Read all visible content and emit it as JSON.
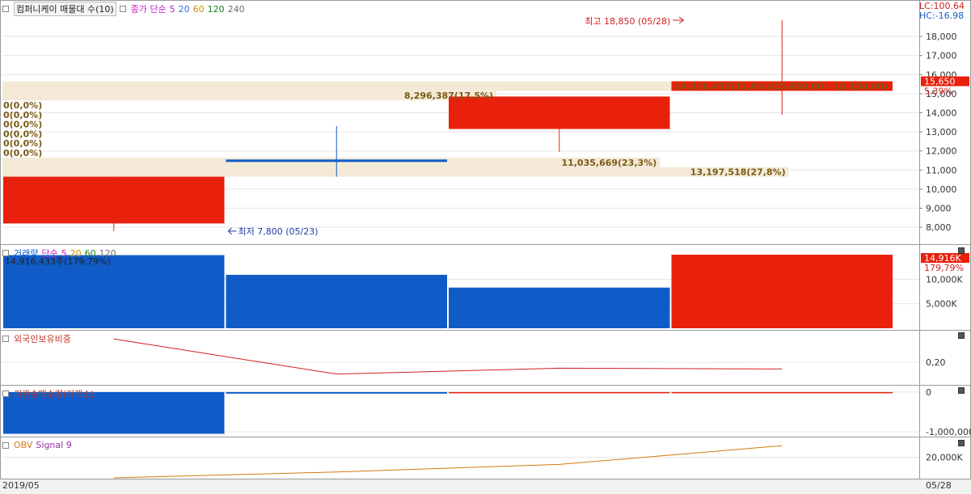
{
  "main_legend": {
    "title": "컴퍼니케이 매물대 수(10)",
    "ma_label": "종가 단순",
    "ma_periods": [
      {
        "label": "5",
        "color": "#c020c0"
      },
      {
        "label": "20",
        "color": "#3070e0"
      },
      {
        "label": "60",
        "color": "#d09000"
      },
      {
        "label": "120",
        "color": "#208020"
      },
      {
        "label": "240",
        "color": "#707070"
      }
    ]
  },
  "top_right": {
    "lc": "LC:100.64",
    "hc": "HC:-16.98"
  },
  "volume_legend": {
    "title": "거래량",
    "ma_label": "단순",
    "periods": [
      {
        "label": "5",
        "color": "#c020c0"
      },
      {
        "label": "20",
        "color": "#d09000"
      },
      {
        "label": "60",
        "color": "#208020"
      },
      {
        "label": "120",
        "color": "#707070"
      }
    ]
  },
  "foreign_title": "외국인보유비중",
  "inst_title": "기관순매수량(거래소)",
  "obv_legend": {
    "obv": "OBV",
    "signal": "Signal 9"
  },
  "bottom_axis": {
    "left": "2019/05",
    "right": "05/28"
  },
  "colors": {
    "up": "#e8200c",
    "down": "#0f5cc8",
    "profile": "#f3e9d6",
    "profile_text": "#7a5a14"
  },
  "chart_data": [
    {
      "type": "candlestick",
      "panel": "price",
      "candles": [
        {
          "open": 10650,
          "high": 10650,
          "low": 7800,
          "close": 8200
        },
        {
          "open": 11550,
          "high": 13300,
          "low": 10650,
          "close": 11450
        },
        {
          "open": 14850,
          "high": 14850,
          "low": 11950,
          "close": 13150
        },
        {
          "open": 15150,
          "high": 18850,
          "low": 13900,
          "close": 15650
        }
      ],
      "ylim": [
        7200,
        19400
      ],
      "yticks": [
        "8,000",
        "9,000",
        "10,000",
        "11,000",
        "12,000",
        "13,000",
        "14,000",
        "15,000",
        "16,000",
        "17,000",
        "18,000"
      ],
      "high_label": "최고 18,850 (05/28)",
      "low_label": "최저 7,800 (05/23)",
      "current_price": "15,650",
      "current_pct": "5,39%",
      "volume_profile": [
        {
          "low": 15150,
          "high": 15650,
          "label": "14,916,433(31,4%)(15,650.00 - 15,150.00)",
          "fraction": 1.0
        },
        {
          "low": 14650,
          "high": 15150,
          "label": "8,296,387(17,5%)",
          "fraction": 0.556
        },
        {
          "low": 14150,
          "high": 14650,
          "label": "0(0,0%)",
          "fraction": 0.0
        },
        {
          "low": 13650,
          "high": 14150,
          "label": "0(0,0%)",
          "fraction": 0.0
        },
        {
          "low": 13150,
          "high": 13650,
          "label": "0(0,0%)",
          "fraction": 0.0
        },
        {
          "low": 12650,
          "high": 13150,
          "label": "0(0,0%)",
          "fraction": 0.0
        },
        {
          "low": 12150,
          "high": 12650,
          "label": "0(0,0%)",
          "fraction": 0.0
        },
        {
          "low": 11650,
          "high": 12150,
          "label": "0(0,0%)",
          "fraction": 0.0
        },
        {
          "low": 11150,
          "high": 11650,
          "label": "11,035,669(23,3%)",
          "fraction": 0.74
        },
        {
          "low": 10650,
          "high": 11150,
          "label": "13,197,518(27,8%)",
          "fraction": 0.885
        }
      ]
    },
    {
      "type": "bar",
      "panel": "volume",
      "values": [
        14916433,
        10900000,
        8296387,
        15000000
      ],
      "colors": [
        "down",
        "down",
        "down",
        "up"
      ],
      "ylim": [
        0,
        15500000
      ],
      "yticks": [
        {
          "v": 5000000,
          "label": "5,000K"
        },
        {
          "v": 10000000,
          "label": "10,000K"
        }
      ],
      "current_label": "14,916K",
      "current_pct": "179,79%",
      "top_label": "14,916,433주(179,79%)"
    },
    {
      "type": "line",
      "panel": "foreign",
      "values": [
        0.48,
        0.06,
        0.13,
        0.12
      ],
      "ylim": [
        -0.05,
        0.55
      ],
      "yticks": [
        {
          "v": 0.2,
          "label": "0,20"
        }
      ]
    },
    {
      "type": "bar",
      "panel": "institution",
      "values": [
        -1050000,
        -40000,
        -5000,
        -2000
      ],
      "ylim": [
        -1100000,
        100000
      ],
      "yticks": [
        {
          "v": 0,
          "label": "0"
        },
        {
          "v": -1000000,
          "label": "-1,000,000"
        }
      ]
    },
    {
      "type": "line",
      "panel": "obv",
      "values": [
        -30000000,
        -5000000,
        8000000,
        40000000
      ],
      "ylim": [
        -15000000,
        50000000
      ],
      "yticks": [
        {
          "v": 20000000,
          "label": "20,000K"
        }
      ]
    }
  ]
}
